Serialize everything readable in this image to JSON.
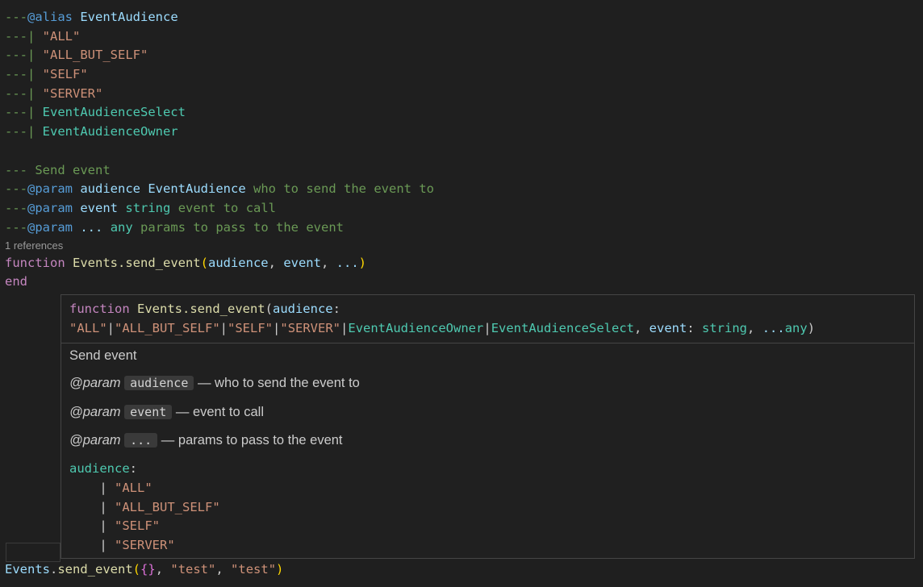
{
  "editor": {
    "alias_prefix": "---",
    "alias_tag": "@alias",
    "alias_name": "EventAudience",
    "union_prefix": "---|",
    "union_members": [
      "\"ALL\"",
      "\"ALL_BUT_SELF\"",
      "\"SELF\"",
      "\"SERVER\"",
      "EventAudienceSelect",
      "EventAudienceOwner"
    ],
    "comment_desc": "--- Send event",
    "param_tag": "@param",
    "params": [
      {
        "name": "audience",
        "type": "EventAudience",
        "desc": "who to send the event to"
      },
      {
        "name": "event",
        "type": "string",
        "desc": "event to call"
      },
      {
        "name": "...",
        "type": "any",
        "desc": "params to pass to the event"
      }
    ],
    "code_lens": "1 references",
    "kw_function": "function",
    "fn_name": "Events.send_event",
    "fn_open": "(",
    "fn_params": "audience",
    "fn_comma1": ", ",
    "fn_param2": "event",
    "fn_comma2": ", ",
    "fn_param3": "...",
    "fn_close": ")",
    "kw_end": "end",
    "call_prefix": "Events",
    "call_dot": ".",
    "call_fn": "send_event",
    "call_open": "(",
    "call_table": "{}",
    "call_sep1": ", ",
    "call_arg2": "\"test\"",
    "call_sep2": ", ",
    "call_arg3": "\"test\"",
    "call_close": ")"
  },
  "hover": {
    "sig_kw": "function",
    "sig_name": "Events.send_event",
    "sig_open": "(",
    "sig_p1": "audience",
    "sig_colon1": ":",
    "sig_union": [
      "\"ALL\"",
      "\"ALL_BUT_SELF\"",
      "\"SELF\"",
      "\"SERVER\"",
      "EventAudienceOwner",
      "EventAudienceSelect"
    ],
    "sig_pipe": "|",
    "sig_comma": ", ",
    "sig_p2": "event",
    "sig_colon2": ": ",
    "sig_t2": "string",
    "sig_p3": "...",
    "sig_t3": "any",
    "sig_close": ")",
    "description": "Send event",
    "param_label": "@param",
    "dash": " — ",
    "params": [
      {
        "name": "audience",
        "desc": "who to send the event to"
      },
      {
        "name": "event",
        "desc": "event to call"
      },
      {
        "name": "...",
        "desc": "params to pass to the event"
      }
    ],
    "enum_header": "audience",
    "enum_colon": ":",
    "enum_pipe": "|",
    "enum_values": [
      "\"ALL\"",
      "\"ALL_BUT_SELF\"",
      "\"SELF\"",
      "\"SERVER\""
    ]
  },
  "colors": {
    "background": "#1f1f1f",
    "comment": "#6a9955",
    "tag": "#569cd6",
    "string": "#ce9178",
    "type": "#4ec9b0",
    "param": "#9cdcfe",
    "keyword": "#c586c0",
    "function": "#dcdcaa"
  }
}
